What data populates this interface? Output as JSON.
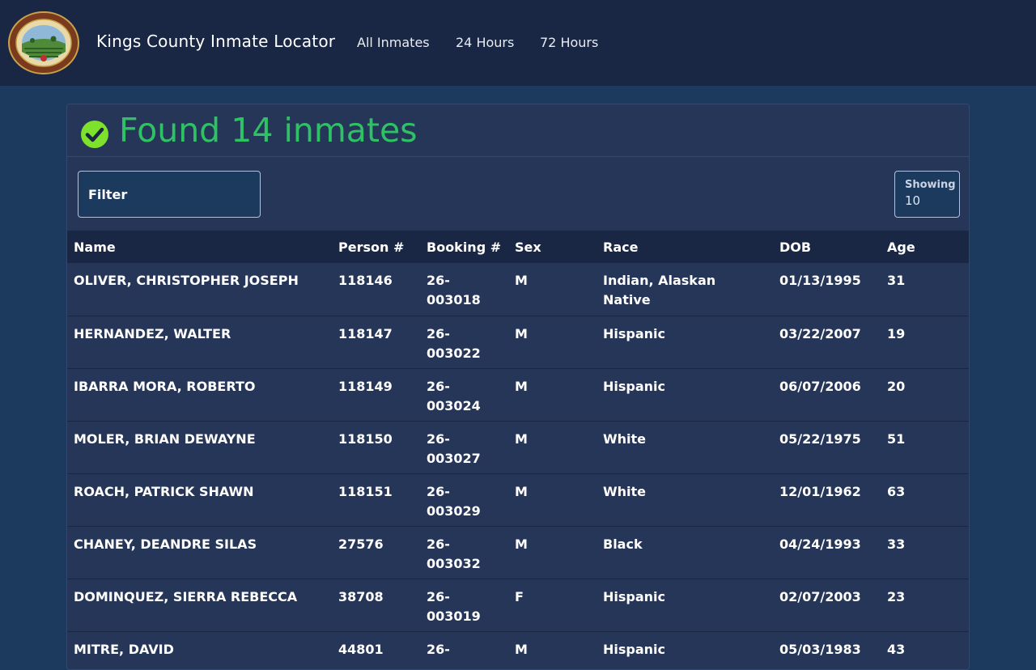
{
  "header": {
    "brand": "Kings County Inmate Locator",
    "nav": [
      "All Inmates",
      "24 Hours",
      "72 Hours"
    ]
  },
  "result": {
    "message": "Found 14 inmates"
  },
  "filter": {
    "placeholder": "Filter"
  },
  "showing": {
    "label": "Showing",
    "value": "10"
  },
  "table": {
    "columns": [
      "Name",
      "Person #",
      "Booking #",
      "Sex",
      "Race",
      "DOB",
      "Age"
    ],
    "rows": [
      [
        "OLIVER, CHRISTOPHER JOSEPH",
        "118146",
        "26-003018",
        "M",
        "Indian, Alaskan Native",
        "01/13/1995",
        "31"
      ],
      [
        "HERNANDEZ, WALTER",
        "118147",
        "26-003022",
        "M",
        "Hispanic",
        "03/22/2007",
        "19"
      ],
      [
        "IBARRA MORA, ROBERTO",
        "118149",
        "26-003024",
        "M",
        "Hispanic",
        "06/07/2006",
        "20"
      ],
      [
        "MOLER, BRIAN DEWAYNE",
        "118150",
        "26-003027",
        "M",
        "White",
        "05/22/1975",
        "51"
      ],
      [
        "ROACH, PATRICK SHAWN",
        "118151",
        "26-003029",
        "M",
        "White",
        "12/01/1962",
        "63"
      ],
      [
        "CHANEY, DEANDRE SILAS",
        "27576",
        "26-003032",
        "M",
        "Black",
        "04/24/1993",
        "33"
      ],
      [
        "DOMINQUEZ, SIERRA REBECCA",
        "38708",
        "26-003019",
        "F",
        "Hispanic",
        "02/07/2003",
        "23"
      ],
      [
        "MITRE, DAVID",
        "44801",
        "26-",
        "M",
        "Hispanic",
        "05/03/1983",
        "43"
      ]
    ]
  },
  "colors": {
    "topbar": "#1a2744",
    "background": "#1b3a5e",
    "card": "#263659",
    "success": "#2ec265",
    "check": "#7ee22c"
  }
}
